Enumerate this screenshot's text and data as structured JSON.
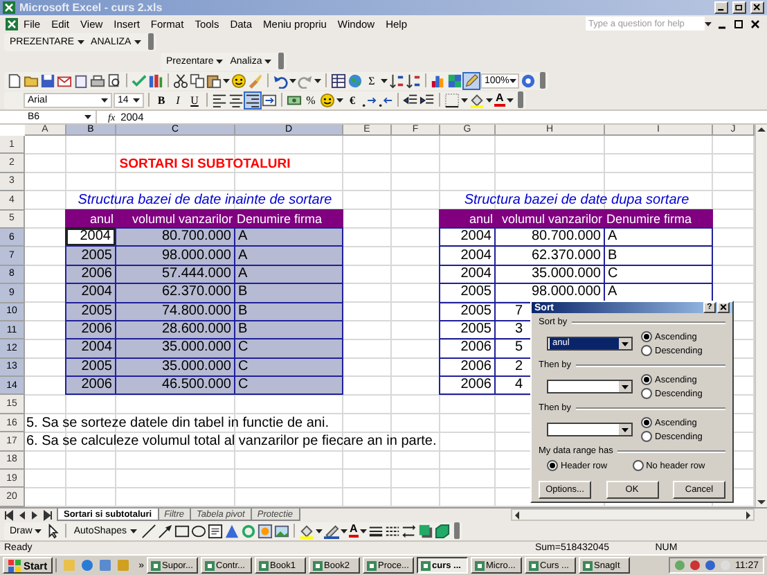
{
  "window": {
    "title": "Microsoft Excel - curs 2.xls"
  },
  "menu": [
    "File",
    "Edit",
    "View",
    "Insert",
    "Format",
    "Tools",
    "Data",
    "Meniu propriu",
    "Window",
    "Help"
  ],
  "help_search": {
    "placeholder": "Type a question for help"
  },
  "custom_toolbar": [
    "PREZENTARE",
    "ANALIZA"
  ],
  "floating_toolbar": [
    "Prezentare",
    "Analiza"
  ],
  "standard_toolbar": {
    "sum": "Σ",
    "zoom": "100%",
    "drawing_pressed": true
  },
  "formatting_toolbar": {
    "font": "Arial",
    "size": "14",
    "bold": "B",
    "italic": "I",
    "underline": "U",
    "percent": "%",
    "euro": "€",
    "font_color": "A",
    "align_right_pressed": true
  },
  "formula_bar": {
    "cell": "B6",
    "fx": "fx",
    "value": "2004"
  },
  "columns": [
    {
      "label": "A",
      "selected": false
    },
    {
      "label": "B",
      "selected": true
    },
    {
      "label": "C",
      "selected": true
    },
    {
      "label": "D",
      "selected": true
    },
    {
      "label": "E",
      "selected": false
    },
    {
      "label": "F",
      "selected": false
    },
    {
      "label": "G",
      "selected": false
    },
    {
      "label": "H",
      "selected": false
    },
    {
      "label": "I",
      "selected": false
    },
    {
      "label": "J",
      "selected": false
    }
  ],
  "rows": [
    {
      "label": "1",
      "selected": false
    },
    {
      "label": "2",
      "selected": false
    },
    {
      "label": "3",
      "selected": false
    },
    {
      "label": "4",
      "selected": false
    },
    {
      "label": "5",
      "selected": false
    },
    {
      "label": "6",
      "selected": true
    },
    {
      "label": "7",
      "selected": true
    },
    {
      "label": "8",
      "selected": true
    },
    {
      "label": "9",
      "selected": true
    },
    {
      "label": "10",
      "selected": true
    },
    {
      "label": "11",
      "selected": true
    },
    {
      "label": "12",
      "selected": true
    },
    {
      "label": "13",
      "selected": true
    },
    {
      "label": "14",
      "selected": true
    },
    {
      "label": "15",
      "selected": false
    },
    {
      "label": "16",
      "selected": false
    },
    {
      "label": "17",
      "selected": false
    },
    {
      "label": "18",
      "selected": false
    },
    {
      "label": "19",
      "selected": false
    },
    {
      "label": "20",
      "selected": false
    }
  ],
  "sheet": {
    "title": "SORTARI SI SUBTOTALURI",
    "tables": [
      {
        "caption": "Structura bazei de date inainte de sortare",
        "selected": true,
        "headers": [
          "anul",
          "volumul vanzarilor",
          "Denumire firma"
        ],
        "rows": [
          {
            "cells": [
              "2004",
              "80.700.000",
              "A"
            ]
          },
          {
            "cells": [
              "2005",
              "98.000.000",
              "A"
            ]
          },
          {
            "cells": [
              "2006",
              "57.444.000",
              "A"
            ]
          },
          {
            "cells": [
              "2004",
              "62.370.000",
              "B"
            ]
          },
          {
            "cells": [
              "2005",
              "74.800.000",
              "B"
            ]
          },
          {
            "cells": [
              "2006",
              "28.600.000",
              "B"
            ]
          },
          {
            "cells": [
              "2004",
              "35.000.000",
              "C"
            ]
          },
          {
            "cells": [
              "2005",
              "35.000.000",
              "C"
            ]
          },
          {
            "cells": [
              "2006",
              "46.500.000",
              "C"
            ]
          }
        ]
      },
      {
        "caption": "Structura bazei de date dupa sortare",
        "selected": false,
        "headers": [
          "anul",
          "volumul vanzarilor",
          "Denumire firma"
        ],
        "rows": [
          {
            "cells": [
              "2004",
              "80.700.000",
              "A"
            ]
          },
          {
            "cells": [
              "2004",
              "62.370.000",
              "B"
            ]
          },
          {
            "cells": [
              "2004",
              "35.000.000",
              "C"
            ]
          },
          {
            "cells": [
              "2005",
              "98.000.000",
              "A"
            ]
          },
          {
            "cells": [
              "2005",
              "7"
            ]
          },
          {
            "cells": [
              "2005",
              "3"
            ]
          },
          {
            "cells": [
              "2006",
              "5"
            ]
          },
          {
            "cells": [
              "2006",
              "2"
            ]
          },
          {
            "cells": [
              "2006",
              "4"
            ]
          }
        ]
      }
    ],
    "notes": [
      "5. Sa se sorteze datele din tabel in functie de ani.",
      "6. Sa se calculeze volumul total al vanzarilor pe fiecare an in parte."
    ]
  },
  "dialog": {
    "title": "Sort",
    "help": "?",
    "groups": [
      {
        "label": "Sort by",
        "value": "anul",
        "options": [
          {
            "label": "Ascending",
            "selected": true
          },
          {
            "label": "Descending",
            "selected": false
          }
        ]
      },
      {
        "label": "Then by",
        "options": [
          {
            "label": "Ascending",
            "selected": true
          },
          {
            "label": "Descending",
            "selected": false
          }
        ]
      },
      {
        "label": "Then by",
        "options": [
          {
            "label": "Ascending",
            "selected": true
          },
          {
            "label": "Descending",
            "selected": false
          }
        ]
      }
    ],
    "header_group": {
      "label": "My data range has",
      "options": [
        {
          "label": "Header row",
          "selected": true
        },
        {
          "label": "No header row",
          "selected": false
        }
      ]
    },
    "buttons": [
      "Options...",
      "OK",
      "Cancel"
    ]
  },
  "sheet_tabs": [
    {
      "label": "Sortari si subtotaluri",
      "selected": true
    },
    {
      "label": "Filtre",
      "selected": false
    },
    {
      "label": "Tabela pivot",
      "selected": false
    },
    {
      "label": "Protectie",
      "selected": false
    }
  ],
  "drawing_toolbar": {
    "draw": "Draw",
    "autoshapes": "AutoShapes",
    "font_color": "A"
  },
  "status_bar": {
    "state": "Ready",
    "sum": "Sum=518432045",
    "num": "NUM"
  },
  "taskbar": {
    "start": "Start",
    "more": "»",
    "items": [
      {
        "label": "Supor...",
        "selected": false
      },
      {
        "label": "Contr...",
        "selected": false
      },
      {
        "label": "Book1",
        "selected": false
      },
      {
        "label": "Book2",
        "selected": false
      },
      {
        "label": "Proce...",
        "selected": false
      },
      {
        "label": "curs ...",
        "selected": true
      },
      {
        "label": "Micro...",
        "selected": false
      },
      {
        "label": "Curs ...",
        "selected": false
      },
      {
        "label": "SnagIt",
        "selected": false
      }
    ],
    "clock": "11:27"
  }
}
